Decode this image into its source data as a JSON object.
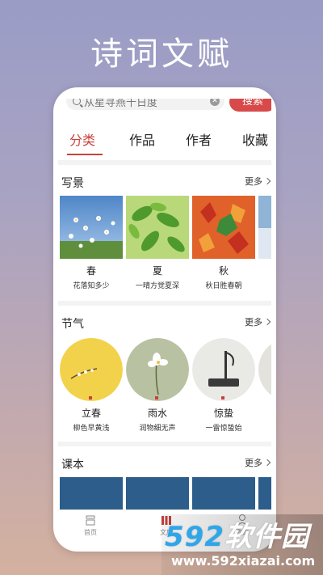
{
  "hero": {
    "title": "诗词文赋"
  },
  "search": {
    "placeholder": "从星寻燕千日度",
    "clear_icon": "close-circle-icon",
    "button_label": "搜索"
  },
  "tabs": [
    {
      "label": "分类",
      "active": true
    },
    {
      "label": "作品",
      "active": false
    },
    {
      "label": "作者",
      "active": false
    },
    {
      "label": "收藏",
      "active": false
    }
  ],
  "sections": {
    "scenery": {
      "title": "写景",
      "more": "更多",
      "items": [
        {
          "name": "春",
          "sub": "花落知多少"
        },
        {
          "name": "夏",
          "sub": "一晴方觉夏深"
        },
        {
          "name": "秋",
          "sub": "秋日胜春朝"
        }
      ]
    },
    "solar_terms": {
      "title": "节气",
      "more": "更多",
      "items": [
        {
          "name": "立春",
          "sub": "柳色早黄浅"
        },
        {
          "name": "雨水",
          "sub": "润物细无声"
        },
        {
          "name": "惊蛰",
          "sub": "一雷惊蛰始"
        }
      ]
    },
    "textbook": {
      "title": "课本",
      "more": "更多"
    }
  },
  "bottom_nav": [
    {
      "label": "首页",
      "icon": "home-icon"
    },
    {
      "label": "文库",
      "icon": "library-icon"
    },
    {
      "label": "我的",
      "icon": "user-icon"
    }
  ],
  "watermark": {
    "brand_number": "592",
    "brand_text": "软件园",
    "url": "www.592xiazai.com"
  },
  "colors": {
    "accent": "#c9413b",
    "search_button": "#d84a4a"
  }
}
